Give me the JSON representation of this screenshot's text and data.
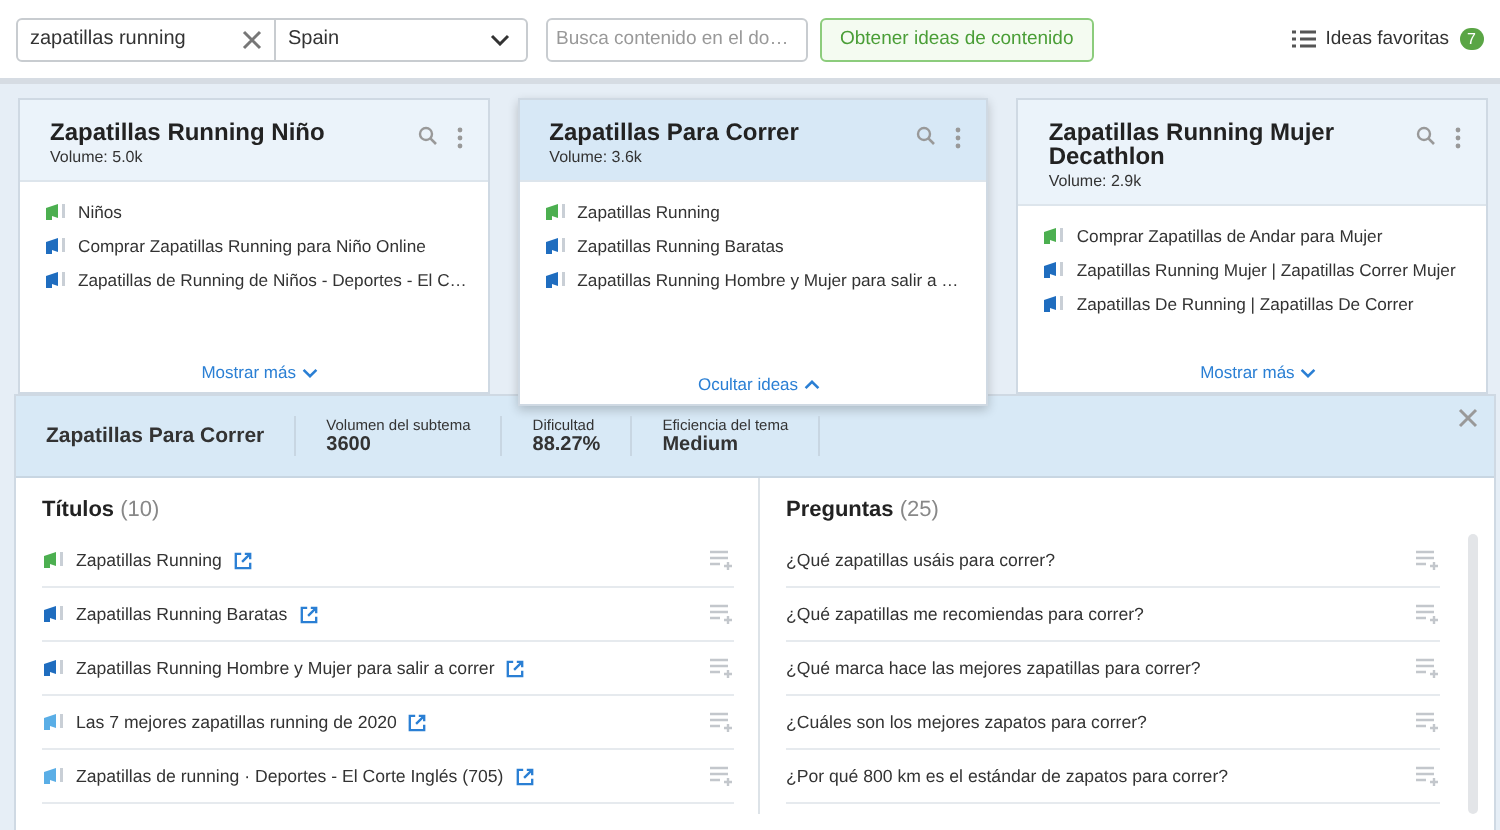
{
  "toolbar": {
    "keyword": "zapatillas running",
    "country": "Spain",
    "search": {
      "placeholder": "Busca contenido en el do…"
    },
    "button": "Obtener ideas de contenido",
    "favorites": {
      "label": "Ideas favoritas",
      "count": "7"
    }
  },
  "cards": [
    {
      "title": "Zapatillas Running Niño",
      "volume_label": "Volume:",
      "volume": "5.0k",
      "selected": false,
      "expanded": false,
      "toggle": "Mostrar más",
      "items": [
        {
          "text": "Niños",
          "color": "#4caf50"
        },
        {
          "text": "Comprar Zapatillas Running para Niño Online",
          "color": "#1f6dbf"
        },
        {
          "text": "Zapatillas de Running de Niños - Deportes - El C…",
          "color": "#1f6dbf"
        }
      ]
    },
    {
      "title": "Zapatillas Para Correr",
      "volume_label": "Volume:",
      "volume": "3.6k",
      "selected": true,
      "expanded": true,
      "toggle": "Ocultar ideas",
      "items": [
        {
          "text": "Zapatillas Running",
          "color": "#4caf50"
        },
        {
          "text": "Zapatillas Running Baratas",
          "color": "#1f6dbf"
        },
        {
          "text": "Zapatillas Running Hombre y Mujer para salir a …",
          "color": "#1f6dbf"
        }
      ]
    },
    {
      "title": "Zapatillas Running Mujer Decathlon",
      "volume_label": "Volume:",
      "volume": "2.9k",
      "selected": false,
      "expanded": false,
      "toggle": "Mostrar más",
      "items": [
        {
          "text": "Comprar Zapatillas de Andar para Mujer",
          "color": "#4caf50"
        },
        {
          "text": "Zapatillas Running Mujer | Zapatillas Correr Mujer",
          "color": "#1f6dbf"
        },
        {
          "text": "Zapatillas De Running | Zapatillas De Correr",
          "color": "#1f6dbf"
        }
      ]
    }
  ],
  "detail": {
    "title": "Zapatillas Para Correr",
    "stats": [
      {
        "label": "Volumen del subtema",
        "value": "3600"
      },
      {
        "label": "Dificultad",
        "value": "88.27%"
      },
      {
        "label": "Eficiencia del tema",
        "value": "Medium"
      }
    ],
    "titles": {
      "heading": "Títulos",
      "count": "(10)",
      "rows": [
        {
          "text": "Zapatillas Running",
          "color": "#4caf50"
        },
        {
          "text": "Zapatillas Running Baratas",
          "color": "#1f6dbf"
        },
        {
          "text": "Zapatillas Running Hombre y Mujer para salir a correr",
          "color": "#1f6dbf"
        },
        {
          "text": "Las 7 mejores zapatillas running de 2020",
          "color": "#5aaee6"
        },
        {
          "text": "Zapatillas de running · Deportes - El Corte Inglés (705)",
          "color": "#5aaee6"
        }
      ]
    },
    "questions": {
      "heading": "Preguntas",
      "count": "(25)",
      "rows": [
        "¿Qué zapatillas usáis para correr?",
        "¿Qué zapatillas me recomiendas para correr?",
        "¿Qué marca hace las mejores zapatillas para correr?",
        "¿Cuáles son los mejores zapatos para correr?",
        "¿Por qué 800 km es el estándar de zapatos para correr?"
      ]
    }
  }
}
